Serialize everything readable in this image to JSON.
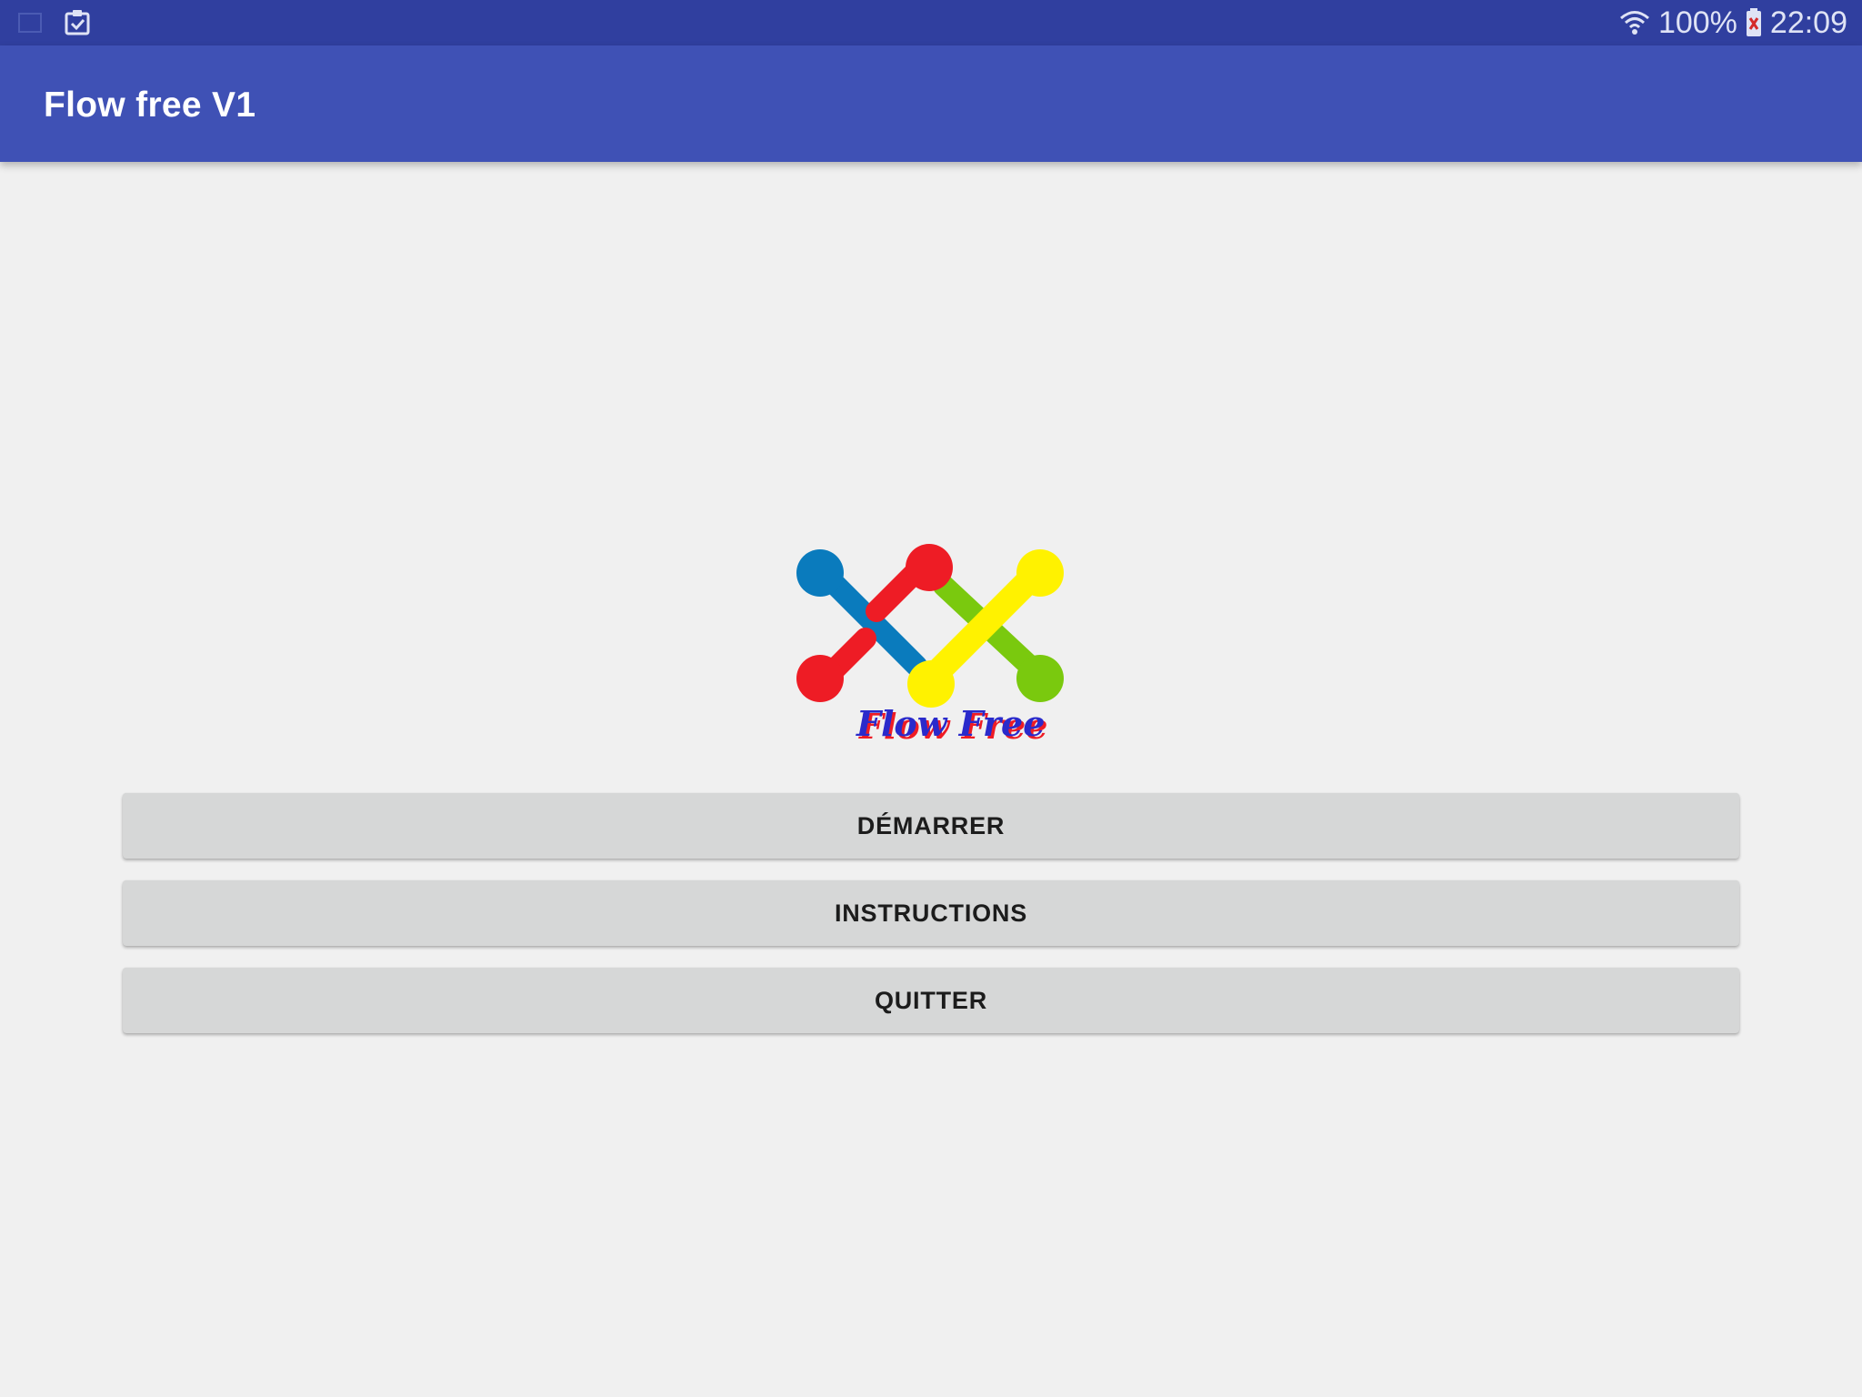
{
  "status_bar": {
    "icons_left": [
      "screenshot-icon",
      "clipboard-check-icon"
    ],
    "battery_percent": "100%",
    "time": "22:09",
    "icons_right": [
      "wifi-icon",
      "battery-icon"
    ],
    "background_color": "#303f9f"
  },
  "app_bar": {
    "title": "Flow free V1",
    "background_color": "#3f51b5"
  },
  "logo": {
    "text": "Flow Free",
    "colors": {
      "blue": "#0a7bbd",
      "red": "#ee1c25",
      "yellow": "#fff200",
      "green": "#7ac90e"
    }
  },
  "menu": {
    "start_label": "DÉMARRER",
    "instructions_label": "INSTRUCTIONS",
    "quit_label": "QUITTER"
  }
}
